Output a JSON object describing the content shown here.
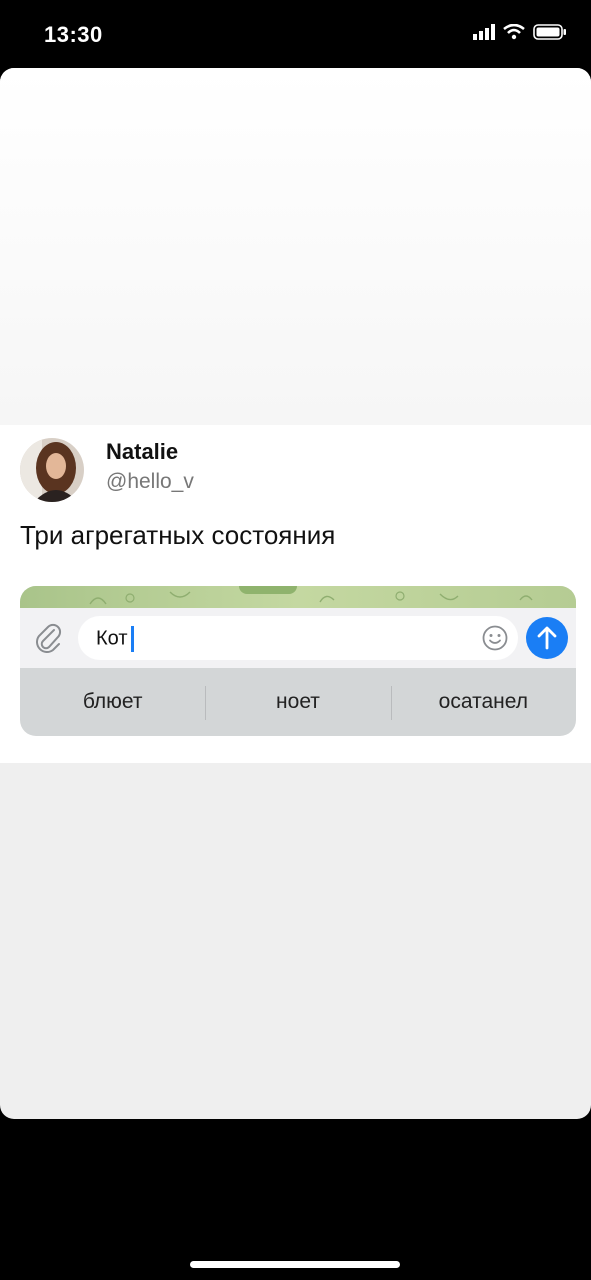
{
  "status": {
    "time": "13:30"
  },
  "tweet": {
    "author_name": "Natalie",
    "author_handle": "@hello_v",
    "text": "Три агрегатных состояния"
  },
  "chat": {
    "input_value": "Кот",
    "suggestions": [
      "блюет",
      "ноет",
      "осатанел"
    ],
    "send_color": "#1a7ef5",
    "icons": [
      "attach-icon",
      "emoji-icon",
      "arrow-up-icon"
    ]
  }
}
